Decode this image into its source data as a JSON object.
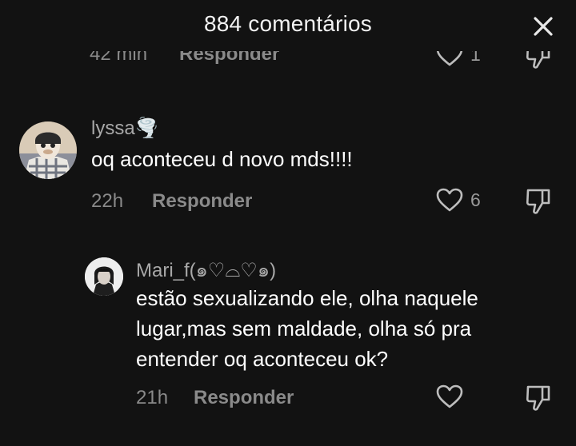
{
  "header": {
    "title": "884 comentários",
    "close_icon": "close-icon"
  },
  "previous_comment": {
    "time": "42 min",
    "reply_label": "Responder",
    "like_count": "1"
  },
  "comments": [
    {
      "username": "lyssa🌪️",
      "text": "oq aconteceu d novo mds!!!!",
      "time": "22h",
      "reply_label": "Responder",
      "like_count": "6"
    },
    {
      "username": "Mari_f(๑♡⌓♡๑)",
      "text_lines": [
        "estão sexualizando ele, olha naquele",
        "lugar,mas sem maldade, olha só pra",
        "entender oq aconteceu ok?"
      ],
      "time": "21h",
      "reply_label": "Responder",
      "like_count": ""
    }
  ],
  "colors": {
    "background": "#121212",
    "text": "#ffffff",
    "muted": "#8a8a8a"
  }
}
